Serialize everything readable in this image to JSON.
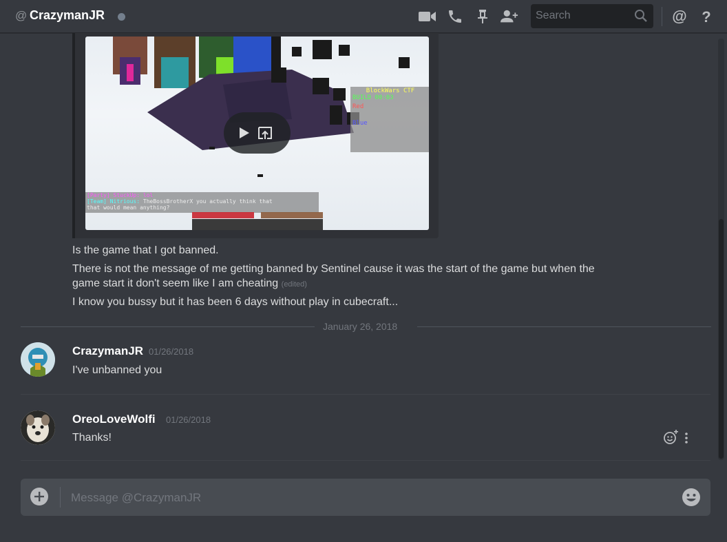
{
  "header": {
    "at_symbol": "@",
    "recipient_name": "CrazymanJR",
    "status_color": "#747f8d",
    "icons": [
      "video-call-icon",
      "voice-call-icon",
      "pin-icon",
      "add-friend-icon"
    ],
    "search_placeholder": "Search",
    "mentions_icon": "at-icon",
    "help_icon": "help-icon"
  },
  "video_embed": {
    "scoreboard_title": "BlockWars CTF",
    "scoreboard_line1": "BUILD 00:03",
    "scoreboard_red": "Red",
    "scoreboard_blue": "Blue",
    "chat_line1": "[Party] StuckUp: lol",
    "chat_line2_prefix": "[Team] Nitrious:",
    "chat_line2_text": "TheBossBrotherX you actually think that",
    "chat_line3": "that would mean anything?",
    "play_icon": "play-icon",
    "open_icon": "open-external-icon"
  },
  "messages_continued": [
    {
      "text": "Is the game that I got banned."
    },
    {
      "text": "There is not the message of me getting banned by Sentinel cause it was the start of the game but when the"
    },
    {
      "text": "game start it don't seem like I am cheating",
      "edited": "(edited)"
    },
    {
      "text": "I know you bussy but it has been 6 days without play in cubecraft..."
    }
  ],
  "date_divider": "January 26, 2018",
  "messages": [
    {
      "author": "CrazymanJR",
      "timestamp": "01/26/2018",
      "text": "I've unbanned you"
    },
    {
      "author": "OreoLoveWolfi",
      "timestamp": "01/26/2018",
      "text": "Thanks!"
    }
  ],
  "composer": {
    "placeholder": "Message @CrazymanJR"
  },
  "colors": {
    "background": "#36393f",
    "composer": "#484c52",
    "text": "#dcddde",
    "muted": "#72767d"
  }
}
